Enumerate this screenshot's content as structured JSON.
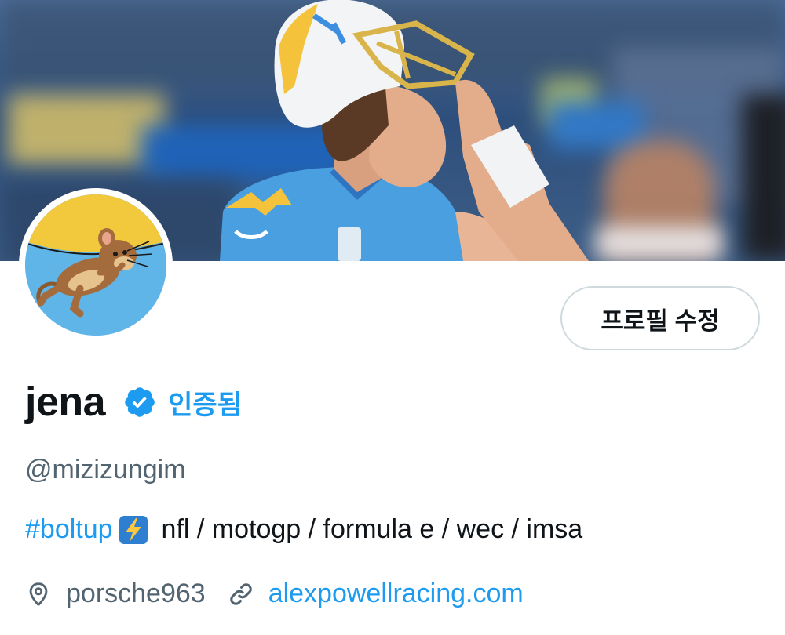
{
  "profile": {
    "display_name": "jena",
    "verified_label": "인증됨",
    "handle": "@mizizungim",
    "edit_button_label": "프로필 수정",
    "bio": {
      "hashtag": "#boltup",
      "emoji": "⚡",
      "text": "nfl / motogp / formula e / wec / imsa"
    },
    "location": "porsche963",
    "website": "alexpowellracing.com",
    "icons": {
      "verified": "verified-badge-icon",
      "bolt": "lightning-emoji-icon",
      "location": "location-pin-icon",
      "link": "link-icon"
    }
  },
  "colors": {
    "accent": "#1d9bf0",
    "text_primary": "#0f1419",
    "text_secondary": "#536471",
    "border": "#cfd9de",
    "jersey": "#4a9fe0"
  }
}
